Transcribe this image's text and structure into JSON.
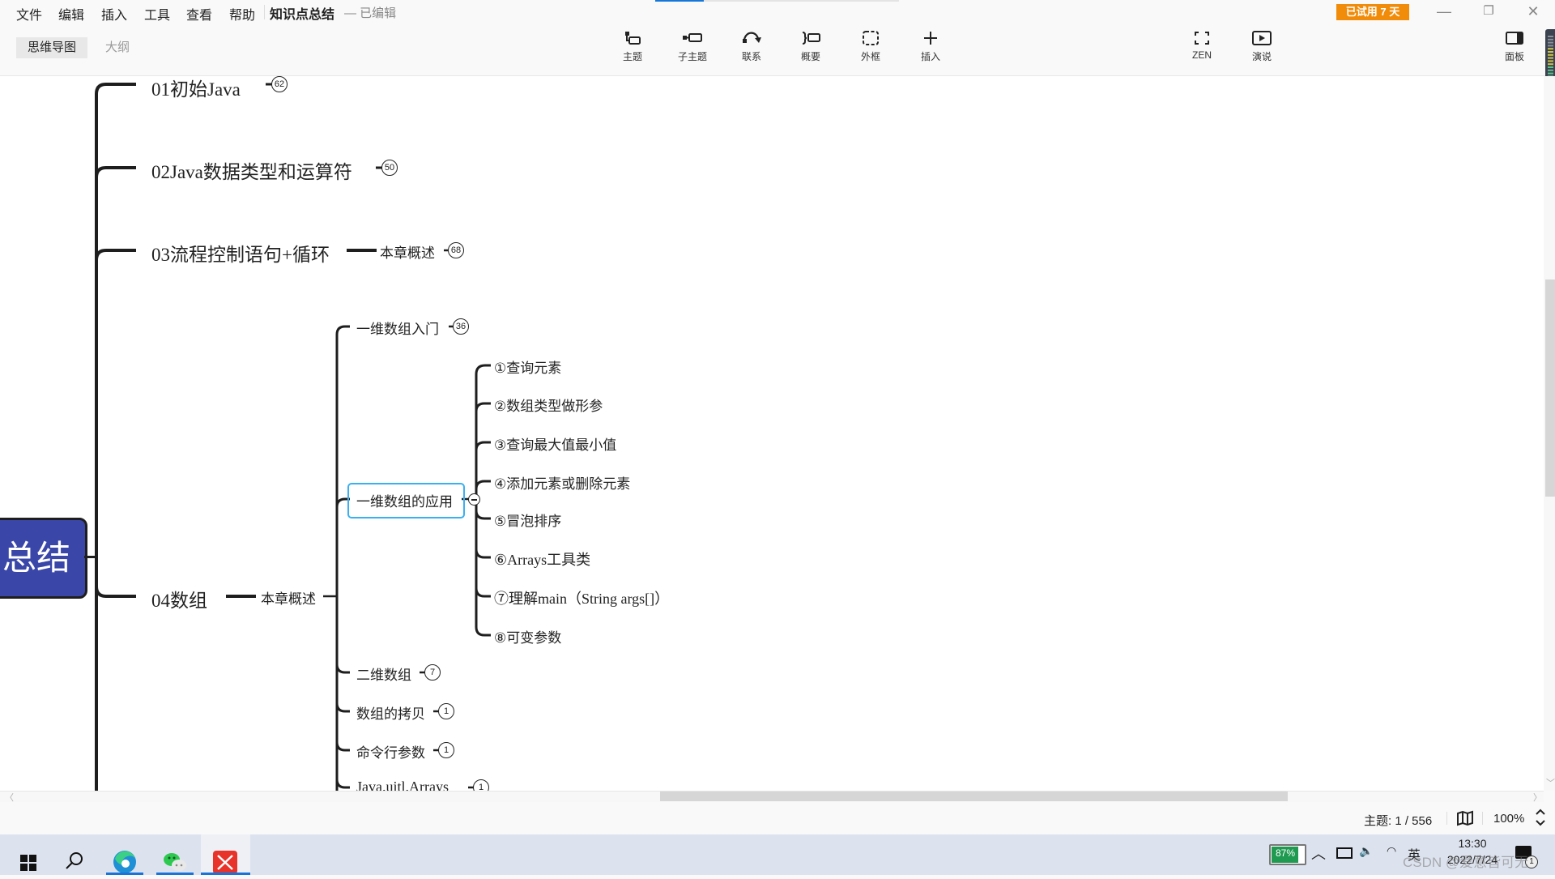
{
  "menubar": {
    "items": [
      "文件",
      "编辑",
      "插入",
      "工具",
      "查看",
      "帮助"
    ],
    "doc_title": "知识点总结",
    "doc_status": "— 已编辑",
    "trial_badge": "已试用 7 天",
    "load_progress_percent": 20,
    "window_controls": {
      "minimize": "—",
      "restore": "❐",
      "close": "✕"
    }
  },
  "toolbar": {
    "view_tabs": [
      {
        "label": "思维导图",
        "active": true
      },
      {
        "label": "大纲",
        "active": false
      }
    ],
    "tools": [
      {
        "label": "主题",
        "icon": "topic-icon"
      },
      {
        "label": "子主题",
        "icon": "subtopic-icon"
      },
      {
        "label": "联系",
        "icon": "relationship-icon"
      },
      {
        "label": "概要",
        "icon": "summary-icon"
      },
      {
        "label": "外框",
        "icon": "boundary-icon"
      },
      {
        "label": "插入",
        "icon": "plus-icon"
      }
    ],
    "right_tools": [
      {
        "label": "ZEN",
        "icon": "zen-fullscreen-icon"
      },
      {
        "label": "演说",
        "icon": "pitch-play-icon"
      }
    ],
    "panel": {
      "label": "面板",
      "icon": "panel-icon"
    }
  },
  "mindmap": {
    "root": {
      "label": "知识点总结",
      "visible_label": "总结",
      "color": "#3a47a8"
    },
    "chapters": [
      {
        "label": "01初始Java",
        "badge": "62"
      },
      {
        "label": "02Java数据类型和运算符",
        "badge": "50"
      },
      {
        "label": "03流程控制语句+循环",
        "child": {
          "label": "本章概述",
          "badge": "68"
        }
      },
      {
        "label": "04数组",
        "child": {
          "label": "本章概述"
        }
      }
    ],
    "array_topics": [
      {
        "label": "一维数组入门",
        "badge": "36"
      },
      {
        "label": "一维数组的应用",
        "selected": true
      },
      {
        "label": "二维数组",
        "badge": "7"
      },
      {
        "label": "数组的拷贝",
        "badge": "1"
      },
      {
        "label": "命令行参数",
        "badge": "1"
      },
      {
        "label": "Java.uitl.Arrays",
        "badge": "1"
      }
    ],
    "application_topics": [
      "①查询元素",
      "②数组类型做形参",
      "③查询最大值最小值",
      "④添加元素或删除元素",
      "⑤冒泡排序",
      "⑥Arrays工具类",
      "⑦理解main（String args[]）",
      "⑧可变参数"
    ],
    "selection_color": "#3ab0f0"
  },
  "statusbar": {
    "topic_count": "主题: 1 / 556",
    "zoom": "100%"
  },
  "taskbar": {
    "apps": [
      {
        "name": "start",
        "icon": "windows-icon"
      },
      {
        "name": "search",
        "icon": "search-icon"
      },
      {
        "name": "edge",
        "icon": "edge-icon",
        "running": true
      },
      {
        "name": "wechat",
        "icon": "wechat-icon",
        "running": true
      },
      {
        "name": "xmind",
        "icon": "xmind-icon",
        "running": true,
        "active": true
      }
    ],
    "battery": "87%",
    "ime": "英",
    "time": "13:30",
    "date": "2022/7/24",
    "notification_count": "1",
    "watermark": "CSDN @爱意皆可无"
  }
}
